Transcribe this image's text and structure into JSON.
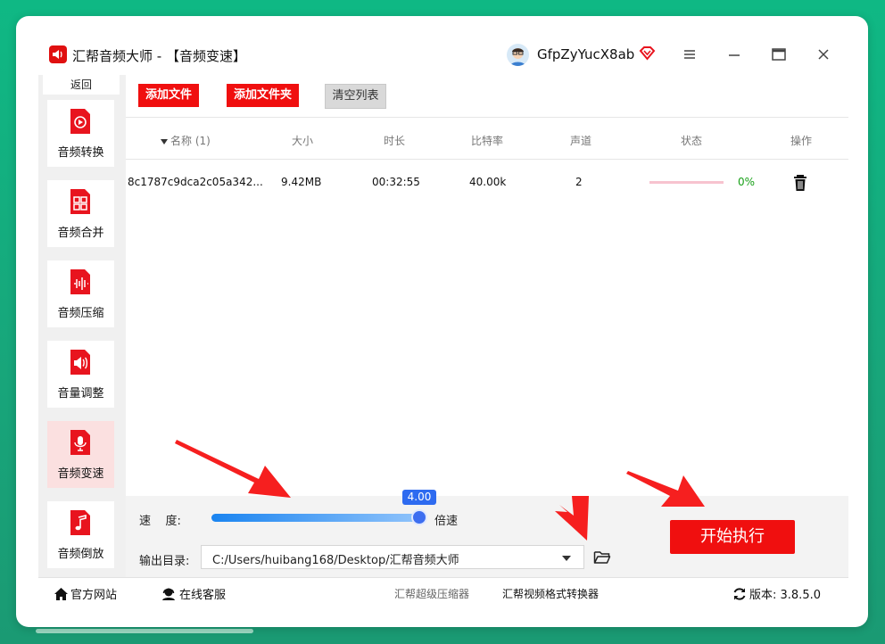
{
  "app": {
    "title": "汇帮音频大师 - 【音频变速】",
    "username": "GfpZyYucX8ab"
  },
  "sidebar": {
    "back_label": "返回",
    "items": [
      {
        "label": "音频转换",
        "icon": "audio-convert-icon"
      },
      {
        "label": "音频合并",
        "icon": "audio-merge-icon"
      },
      {
        "label": "音频压缩",
        "icon": "audio-compress-icon"
      },
      {
        "label": "音量调整",
        "icon": "volume-adjust-icon"
      },
      {
        "label": "音频变速",
        "icon": "audio-speed-icon",
        "active": true
      },
      {
        "label": "音频倒放",
        "icon": "audio-reverse-icon"
      }
    ]
  },
  "toolbar": {
    "add_file": "添加文件",
    "add_folder": "添加文件夹",
    "clear_list": "清空列表"
  },
  "table": {
    "headers": {
      "name": "名称 (1)",
      "size": "大小",
      "duration": "时长",
      "bitrate": "比特率",
      "channels": "声道",
      "status": "状态",
      "action": "操作"
    },
    "rows": [
      {
        "name": "8c1787c9dca2c05a342...",
        "size": "9.42MB",
        "duration": "00:32:55",
        "bitrate": "40.00k",
        "channels": "2",
        "progress": 0,
        "progress_text": "0%"
      }
    ]
  },
  "controls": {
    "speed_label": "速    度:",
    "speed_value": "4.00",
    "speed_fraction": 1.0,
    "speed_unit": "倍速",
    "output_label": "输出目录:",
    "output_path": "C:/Users/huibang168/Desktop/汇帮音频大师",
    "start_label": "开始执行"
  },
  "footer": {
    "website": "官方网站",
    "support": "在线客服",
    "link1": "汇帮超级压缩器",
    "link2": "汇帮视频格式转换器",
    "version": "版本: 3.8.5.0"
  },
  "colors": {
    "accent_red": "#f00f0f",
    "slider_blue": "#2e6bf0",
    "progress_green": "#18a018",
    "background_green": "#18a57a"
  }
}
